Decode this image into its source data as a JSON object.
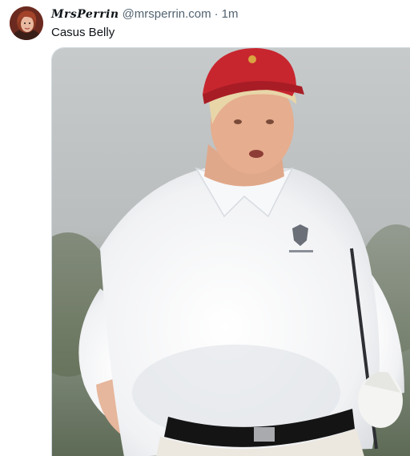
{
  "post": {
    "author": {
      "display_name": "MrsPerrin",
      "handle": "@mrsperrin.com",
      "avatar": "profile-photo"
    },
    "separator": "·",
    "timestamp": "1m",
    "text": "Casus Belly",
    "media": {
      "kind": "photo",
      "description_icon": "golfer-photo"
    }
  },
  "colors": {
    "text_primary": "#0f1419",
    "text_secondary": "#536471",
    "media_border": "#cfd9de",
    "cap_red": "#c8262f"
  }
}
